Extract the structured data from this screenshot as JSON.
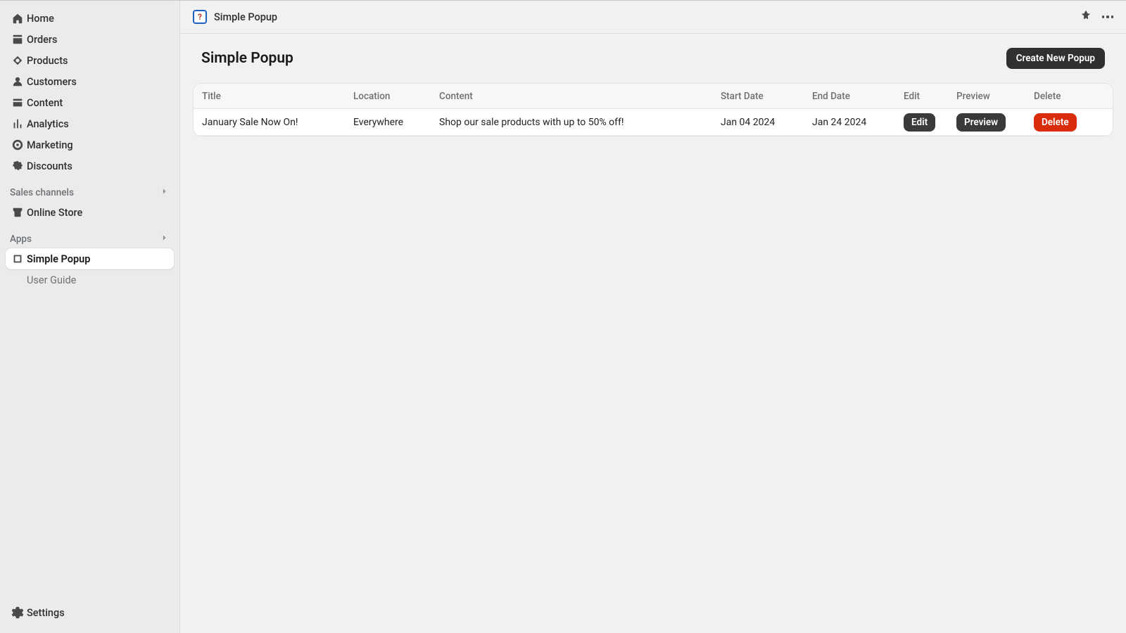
{
  "topbar": {
    "app_name": "Simple Popup",
    "app_icon_glyph": "?"
  },
  "sidebar": {
    "main_items": [
      {
        "label": "Home",
        "icon": "home"
      },
      {
        "label": "Orders",
        "icon": "orders"
      },
      {
        "label": "Products",
        "icon": "products"
      },
      {
        "label": "Customers",
        "icon": "customers"
      },
      {
        "label": "Content",
        "icon": "content"
      },
      {
        "label": "Analytics",
        "icon": "analytics"
      },
      {
        "label": "Marketing",
        "icon": "marketing"
      },
      {
        "label": "Discounts",
        "icon": "discounts"
      }
    ],
    "channels_heading": "Sales channels",
    "channels_items": [
      {
        "label": "Online Store",
        "icon": "store"
      }
    ],
    "apps_heading": "Apps",
    "apps_items": [
      {
        "label": "Simple Popup",
        "icon": "popup",
        "active": true
      },
      {
        "label": "User Guide",
        "sub": true
      }
    ],
    "settings_label": "Settings"
  },
  "page": {
    "title": "Simple Popup",
    "create_button": "Create New Popup"
  },
  "table": {
    "columns": {
      "title": "Title",
      "location": "Location",
      "content": "Content",
      "start_date": "Start Date",
      "end_date": "End Date",
      "edit": "Edit",
      "preview": "Preview",
      "delete": "Delete"
    },
    "rows": [
      {
        "title": "January Sale Now On!",
        "location": "Everywhere",
        "content": "Shop our sale products with up to 50% off!",
        "start_date": "Jan 04 2024",
        "end_date": "Jan 24 2024",
        "edit_label": "Edit",
        "preview_label": "Preview",
        "delete_label": "Delete"
      }
    ]
  }
}
